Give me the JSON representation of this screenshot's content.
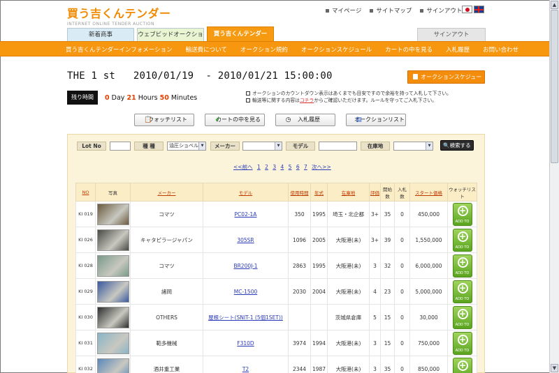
{
  "header": {
    "logo": "買う吉くんテンダー",
    "logo_sub": "INTERNET ONLINE TENDER AUCTION",
    "top_links": [
      "マイページ",
      "サイトマップ",
      "サインアウト"
    ],
    "languages": [
      "jp-flag",
      "uk-flag"
    ]
  },
  "tabs": [
    "新着商事",
    "ウェブビッドオークション",
    "買う吉くんテンダー"
  ],
  "signout_tab": "サインアウト",
  "nav": [
    "買う吉くんテンダーインフォメーション",
    "輸送費について",
    "オークション規約",
    "オークションスケジュール",
    "カートの中を見る",
    "入札履歴",
    "お問い合わせ"
  ],
  "auction": {
    "title": "THE 1 st   2010/01/19  - 2010/01/21 15:00:00",
    "schedule_button": "オークションスケジュール",
    "remaining_label": "残り時間",
    "countdown": {
      "days": "0",
      "day_label": "Day",
      "hours": "21",
      "hours_label": "Hours",
      "minutes": "50",
      "minutes_label": "Minutes"
    },
    "notes": [
      {
        "text": "オークションのカウントダウン表示はあくまでも目安ですので余裕を持って入札して下さい。",
        "link": ""
      },
      {
        "text_before": "輸送等に関する内容は",
        "link": "コチラ",
        "text_after": "からご確認いただけます。ルールを守ってご入札下さい。"
      }
    ]
  },
  "action_buttons": [
    {
      "label": "ウォッチリスト",
      "icon": "clipboard-icon"
    },
    {
      "label": "カートの中を見る",
      "icon": "check-icon"
    },
    {
      "label": "入札履歴",
      "icon": "clock-icon"
    },
    {
      "label": "オークションリスト",
      "icon": "list-icon"
    }
  ],
  "search": {
    "lot_label": "Lot No",
    "category_label": "種 種",
    "category_value": "油圧ショベル",
    "maker_label": "メーカー",
    "model_label": "モデル",
    "location_label": "在庫地",
    "search_button": "検索する"
  },
  "pager": {
    "prev": "<<前へ",
    "pages": [
      "1",
      "2",
      "3",
      "4",
      "5",
      "6",
      "7"
    ],
    "next": "次へ>>"
  },
  "table": {
    "headers": [
      "NO",
      "写真",
      "メーカー",
      "モデル",
      "使用時間",
      "年式",
      "在庫地",
      "評価",
      "開始数",
      "入札数",
      "スタート価格",
      "ウォッチリスト"
    ],
    "add_label": "ADD TO",
    "rows": [
      {
        "no": "KI 019",
        "maker": "コマツ",
        "model": "PC02-1A",
        "hours": "350",
        "year": "1995",
        "location": "埼玉・北企都",
        "grade": "3+",
        "start": "35",
        "bids": "0",
        "price": "450,000"
      },
      {
        "no": "KI 026",
        "maker": "キャタピラージャパン",
        "model": "305SR",
        "hours": "1096",
        "year": "2005",
        "location": "大阪港(未)",
        "grade": "3+",
        "start": "39",
        "bids": "0",
        "price": "1,550,000"
      },
      {
        "no": "KI 028",
        "maker": "コマツ",
        "model": "BR200J-1",
        "hours": "2863",
        "year": "1995",
        "location": "大阪港(未)",
        "grade": "3",
        "start": "32",
        "bids": "0",
        "price": "6,000,000"
      },
      {
        "no": "KI 029",
        "maker": "諸岡",
        "model": "MC-1500",
        "hours": "2030",
        "year": "2004",
        "location": "大阪港(未)",
        "grade": "4",
        "start": "23",
        "bids": "0",
        "price": "5,000,000"
      },
      {
        "no": "KI 030",
        "maker": "OTHERS",
        "model": "屋根シート(SNIT-1 (5個1SET))",
        "hours": "",
        "year": "",
        "location": "茨城県倉庫",
        "grade": "5",
        "start": "15",
        "bids": "0",
        "price": "30,000"
      },
      {
        "no": "KI 031",
        "maker": "範多機械",
        "model": "F310D",
        "hours": "3974",
        "year": "1994",
        "location": "大阪港(未)",
        "grade": "3",
        "start": "15",
        "bids": "0",
        "price": "750,000"
      },
      {
        "no": "KI 032",
        "maker": "酒井重工業",
        "model": "T2",
        "hours": "2344",
        "year": "1987",
        "location": "大阪港(未)",
        "grade": "3",
        "start": "35",
        "bids": "0",
        "price": "850,000"
      }
    ]
  },
  "colors": {
    "accent": "#f7960f",
    "link": "#2a3ab8",
    "header_text": "#c03a00",
    "add_green": "#6cb42c"
  }
}
